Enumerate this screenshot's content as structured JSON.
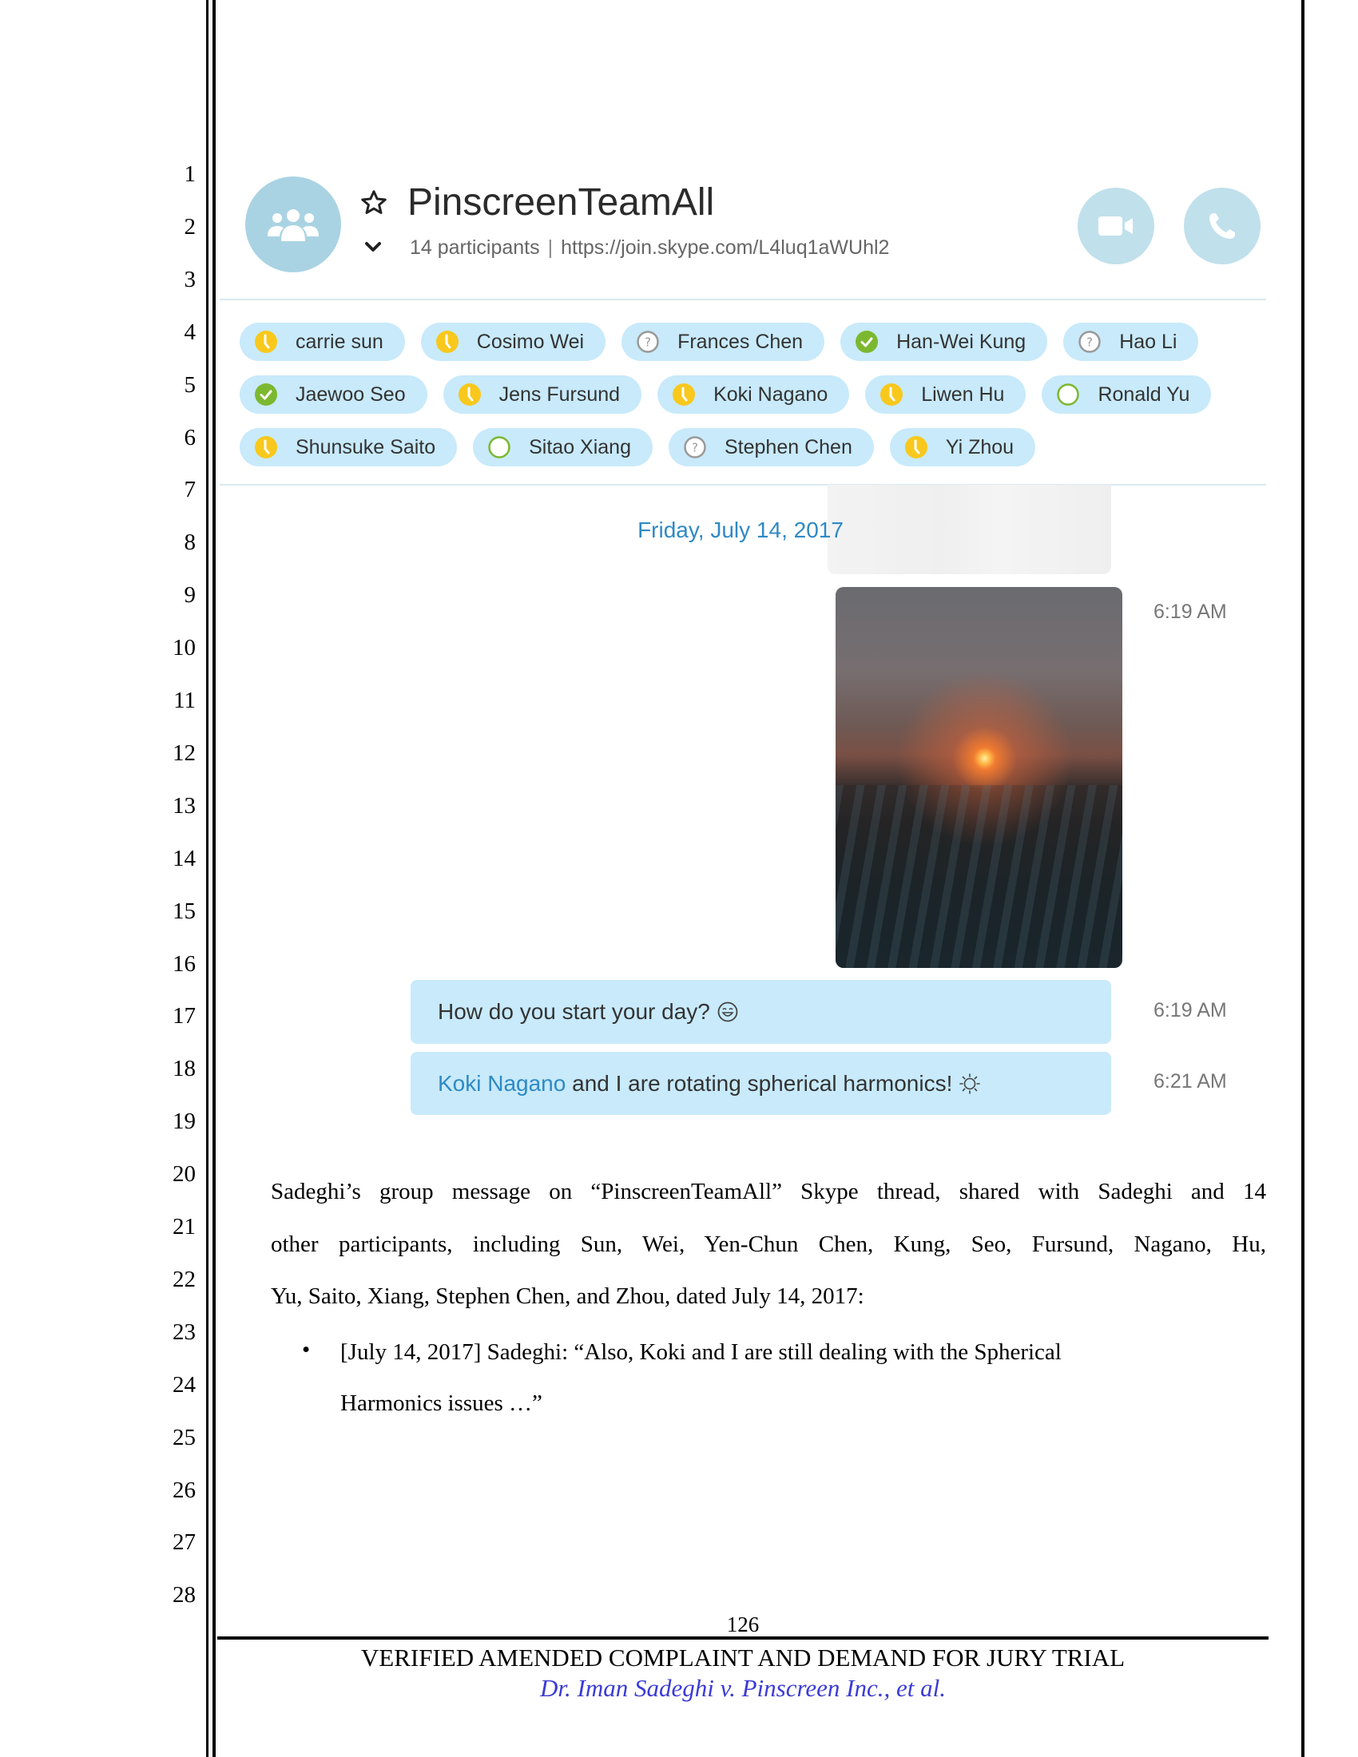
{
  "line_numbers": [
    "1",
    "2",
    "3",
    "4",
    "5",
    "6",
    "7",
    "8",
    "9",
    "10",
    "11",
    "12",
    "13",
    "14",
    "15",
    "16",
    "17",
    "18",
    "19",
    "20",
    "21",
    "22",
    "23",
    "24",
    "25",
    "26",
    "27",
    "28"
  ],
  "skype": {
    "header": {
      "title": "PinscreenTeamAll",
      "participants_count": "14 participants",
      "separator": "|",
      "join_link": "https://join.skype.com/L4luq1aWUhl2",
      "icons": {
        "avatar": "group-icon",
        "favorite": "star-outline-icon",
        "expand": "chevron-down-icon",
        "video_call": "video-camera-icon",
        "audio_call": "phone-icon"
      }
    },
    "participants": [
      [
        {
          "name": "carrie sun",
          "status": "away"
        },
        {
          "name": "Cosimo Wei",
          "status": "away"
        },
        {
          "name": "Frances Chen",
          "status": "unknown"
        },
        {
          "name": "Han-Wei Kung",
          "status": "online"
        },
        {
          "name": "Hao Li",
          "status": "unknown"
        }
      ],
      [
        {
          "name": "Jaewoo Seo",
          "status": "online"
        },
        {
          "name": "Jens Fursund",
          "status": "away"
        },
        {
          "name": "Koki Nagano",
          "status": "away"
        },
        {
          "name": "Liwen Hu",
          "status": "away"
        },
        {
          "name": "Ronald Yu",
          "status": "offline"
        }
      ],
      [
        {
          "name": "Shunsuke Saito",
          "status": "away"
        },
        {
          "name": "Sitao Xiang",
          "status": "offline"
        },
        {
          "name": "Stephen Chen",
          "status": "unknown"
        },
        {
          "name": "Yi Zhou",
          "status": "away"
        }
      ]
    ],
    "status_colors": {
      "away": "#f8c81c",
      "online": "#7cb82f",
      "unknown": "#9a9a9a",
      "offline": "#7cb82f"
    },
    "conversation": {
      "date_separator": "Friday, July 14, 2017",
      "photo_message": {
        "alt": "Sunrise over city skyline photo",
        "time": "6:19 AM"
      },
      "messages": [
        {
          "text": "How do you start your day?",
          "emoticon": "smile-emoticon-icon",
          "time": "6:19 AM"
        },
        {
          "mention": "Koki Nagano",
          "text": " and I are rotating spherical harmonics!",
          "emoticon": "sun-emoticon-icon",
          "time": "6:21 AM"
        }
      ]
    },
    "colors": {
      "accent": "#2e8ac4",
      "bubble": "#c8eafb",
      "avatar_bg": "#a9d3e3",
      "call_button_bg": "#c0e0ec"
    }
  },
  "body": {
    "paragraph_lines": [
      "Sadeghi’s group message on “PinscreenTeamAll” Skype thread, shared with Sadeghi and 14",
      "other participants, including Sun, Wei, Yen-Chun Chen, Kung, Seo, Fursund, Nagano, Hu,",
      "Yu, Saito, Xiang, Stephen Chen, and Zhou, dated July 14, 2017:"
    ],
    "bullets": [
      {
        "symbol": "•",
        "lines": [
          "[July 14, 2017] Sadeghi: “Also, Koki and I are still dealing with the Spherical",
          "Harmonics issues …”"
        ]
      }
    ]
  },
  "footer": {
    "page_number": "126",
    "title": "VERIFIED AMENDED COMPLAINT AND DEMAND FOR JURY TRIAL",
    "case_caption": "Dr. Iman Sadeghi v. Pinscreen Inc., et al.",
    "caption_color": "#3b3bd6"
  }
}
